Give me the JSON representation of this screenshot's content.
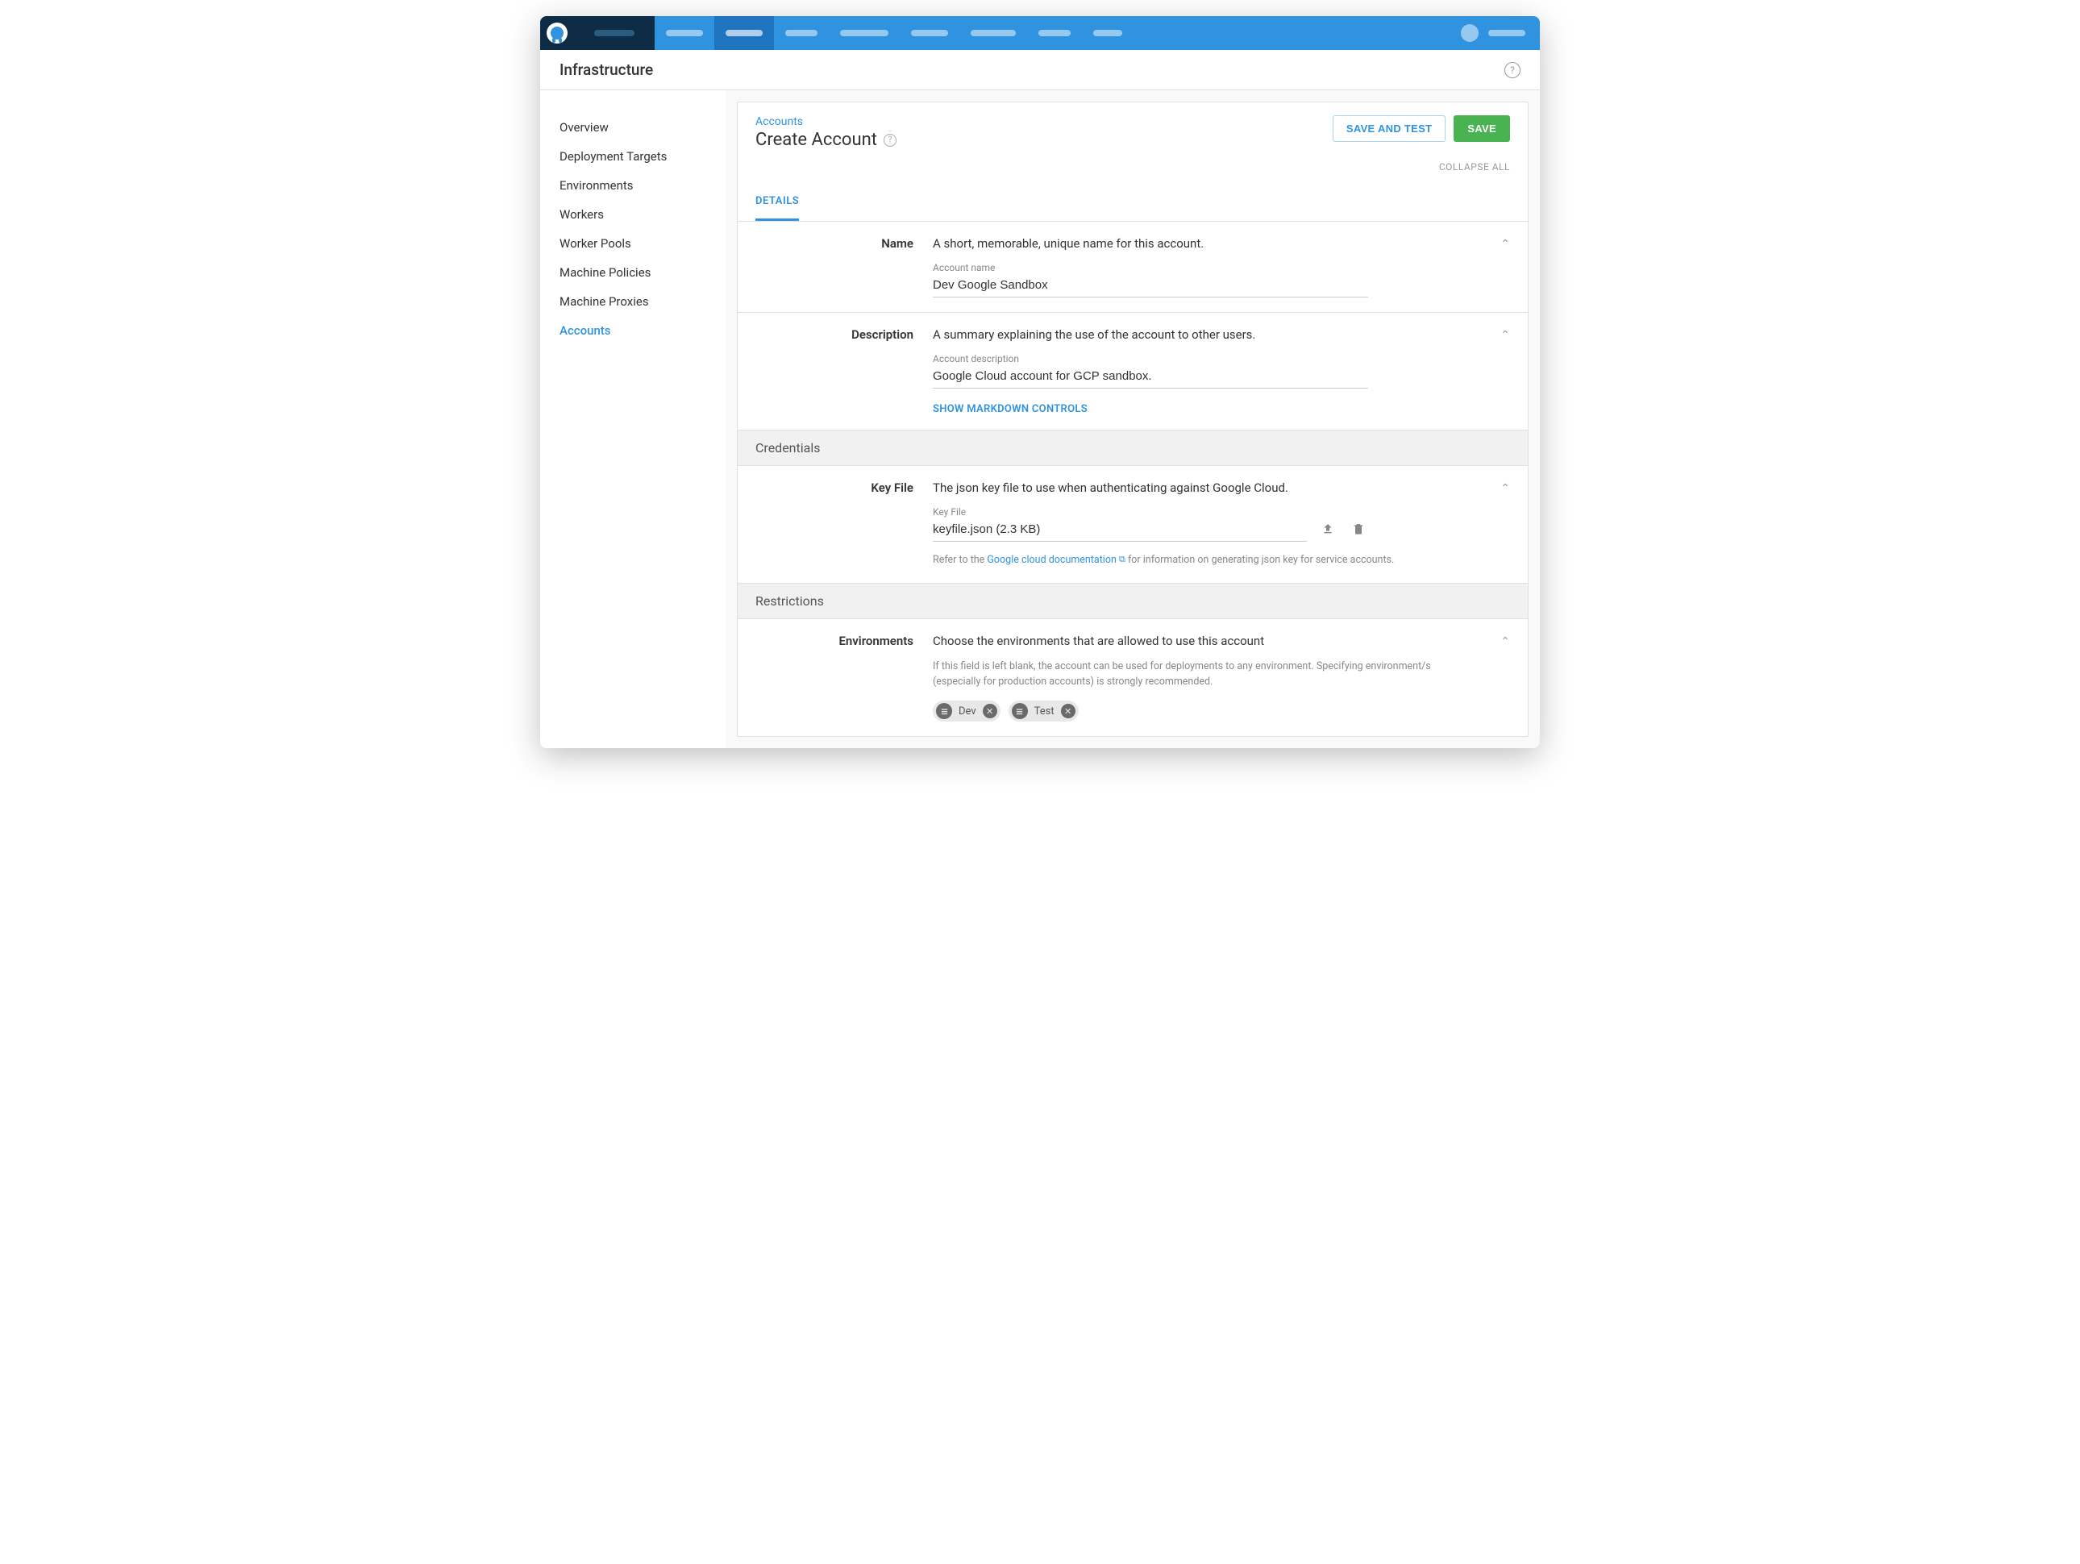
{
  "page": {
    "title": "Infrastructure"
  },
  "sidebar": {
    "items": [
      {
        "label": "Overview"
      },
      {
        "label": "Deployment Targets"
      },
      {
        "label": "Environments"
      },
      {
        "label": "Workers"
      },
      {
        "label": "Worker Pools"
      },
      {
        "label": "Machine Policies"
      },
      {
        "label": "Machine Proxies"
      },
      {
        "label": "Accounts"
      }
    ]
  },
  "header": {
    "breadcrumb": "Accounts",
    "title": "Create Account",
    "save_and_test": "SAVE AND TEST",
    "save": "SAVE",
    "collapse_all": "COLLAPSE ALL"
  },
  "tabs": {
    "details": "DETAILS"
  },
  "form": {
    "name": {
      "label": "Name",
      "desc": "A short, memorable, unique name for this account.",
      "input_label": "Account name",
      "value": "Dev Google Sandbox"
    },
    "description": {
      "label": "Description",
      "desc": "A summary explaining the use of the account to other users.",
      "input_label": "Account description",
      "value": "Google Cloud account for GCP sandbox.",
      "markdown_toggle": "SHOW MARKDOWN CONTROLS"
    },
    "credentials": {
      "section_title": "Credentials",
      "keyfile": {
        "label": "Key File",
        "desc": "The json key file to use when authenticating against Google Cloud.",
        "input_label": "Key File",
        "value": "keyfile.json (2.3 KB)",
        "hint_prefix": "Refer to the ",
        "hint_link": "Google cloud documentation",
        "hint_suffix": " for information on generating json key for service accounts."
      }
    },
    "restrictions": {
      "section_title": "Restrictions",
      "environments": {
        "label": "Environments",
        "desc": "Choose the environments that are allowed to use this account",
        "hint": "If this field is left blank, the account can be used for deployments to any environment. Specifying environment/s (especially for production accounts) is strongly recommended.",
        "chips": [
          {
            "label": "Dev"
          },
          {
            "label": "Test"
          }
        ]
      }
    }
  }
}
